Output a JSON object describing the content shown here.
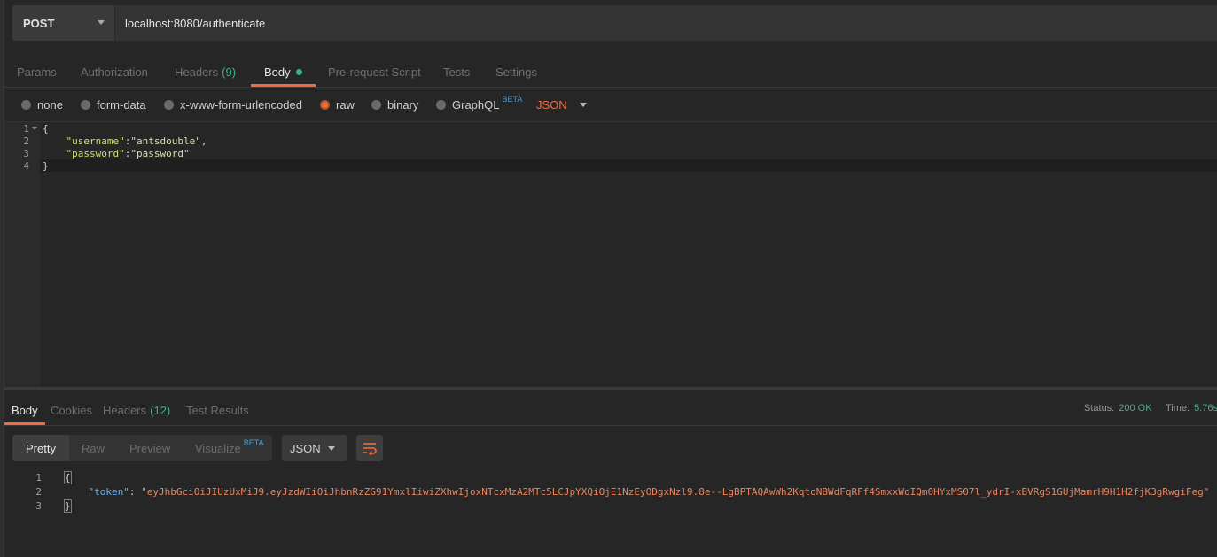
{
  "request": {
    "method": "POST",
    "url": "localhost:8080/authenticate"
  },
  "request_tabs": [
    {
      "label": "Params"
    },
    {
      "label": "Authorization"
    },
    {
      "label": "Headers",
      "count": "(9)"
    },
    {
      "label": "Body"
    },
    {
      "label": "Pre-request Script"
    },
    {
      "label": "Tests"
    },
    {
      "label": "Settings"
    }
  ],
  "body_types": [
    {
      "label": "none"
    },
    {
      "label": "form-data"
    },
    {
      "label": "x-www-form-urlencoded"
    },
    {
      "label": "raw"
    },
    {
      "label": "binary"
    },
    {
      "label": "GraphQL",
      "badge": "BETA"
    }
  ],
  "body_format": "JSON",
  "request_body": {
    "line_numbers": [
      "1",
      "2",
      "3",
      "4"
    ],
    "open_brace": "{",
    "close_brace": "}",
    "username_key": "\"username\"",
    "username_value": "\"antsdouble\"",
    "password_key": "\"password\"",
    "password_value": "\"password\""
  },
  "response_tabs": [
    {
      "label": "Body"
    },
    {
      "label": "Cookies"
    },
    {
      "label": "Headers",
      "count": "(12)"
    },
    {
      "label": "Test Results"
    }
  ],
  "response_status": {
    "status_label": "Status:",
    "status_value": "200 OK",
    "time_label": "Time:",
    "time_value": "5.76s"
  },
  "response_views": [
    {
      "label": "Pretty"
    },
    {
      "label": "Raw"
    },
    {
      "label": "Preview"
    },
    {
      "label": "Visualize",
      "badge": "BETA"
    }
  ],
  "response_format": "JSON",
  "response_body": {
    "line_numbers": [
      "1",
      "2",
      "3"
    ],
    "open_brace": "{",
    "close_brace": "}",
    "token_key": "\"token\"",
    "token_value": "\"eyJhbGciOiJIUzUxMiJ9.eyJzdWIiOiJhbnRzZG91YmxlIiwiZXhwIjoxNTcxMzA2MTc5LCJpYXQiOjE1NzEyODgxNzl9.8e--LgBPTAQAwWh2KqtoNBWdFqRFf4SmxxWoIQm0HYxMS07l_ydrI-xBVRgS1GUjMamrH9H1H2fjK3gRwgiFeg\""
  },
  "colors": {
    "accent": "#f26b3a",
    "success": "#3fb37f",
    "beta": "#3b9de0"
  }
}
